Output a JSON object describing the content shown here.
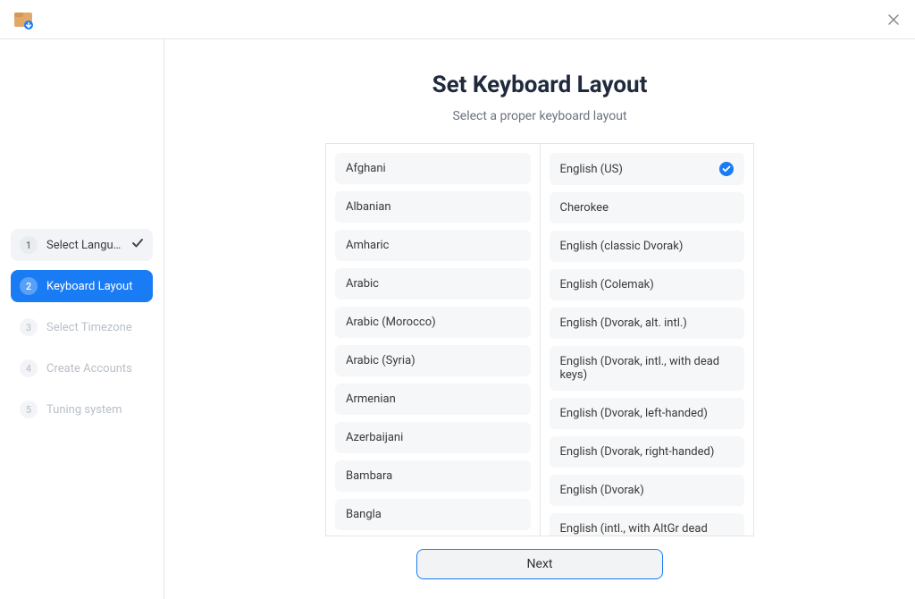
{
  "sidebar": {
    "steps": [
      {
        "num": "1",
        "label": "Select Langu…",
        "state": "completed"
      },
      {
        "num": "2",
        "label": "Keyboard Layout",
        "state": "active"
      },
      {
        "num": "3",
        "label": "Select Timezone",
        "state": "upcoming"
      },
      {
        "num": "4",
        "label": "Create Accounts",
        "state": "upcoming"
      },
      {
        "num": "5",
        "label": "Tuning system",
        "state": "upcoming"
      }
    ]
  },
  "main": {
    "title": "Set Keyboard Layout",
    "subtitle": "Select a proper keyboard layout",
    "left_options": [
      "Afghani",
      "Albanian",
      "Amharic",
      "Arabic",
      "Arabic (Morocco)",
      "Arabic (Syria)",
      "Armenian",
      "Azerbaijani",
      "Bambara",
      "Bangla"
    ],
    "left_partial": "",
    "right_options": [
      "English (US)",
      "Cherokee",
      "English (classic Dvorak)",
      "English (Colemak)",
      "English (Dvorak, alt. intl.)",
      "English (Dvorak, intl., with dead keys)",
      "English (Dvorak, left-handed)",
      "English (Dvorak, right-handed)",
      "English (Dvorak)",
      "English (intl., with AltGr dead keys)"
    ],
    "right_selected_index": 0,
    "next_label": "Next"
  }
}
